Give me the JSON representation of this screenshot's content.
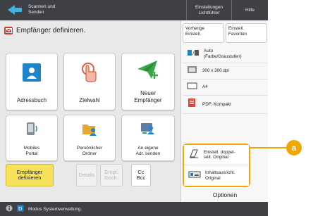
{
  "topbar": {
    "back_label": "Scannen und\nSenden",
    "settings_label": "Einstellungen\nLichtfühler",
    "help_label": "Hilfe"
  },
  "header": {
    "title": "Empfänger definieren."
  },
  "tiles": [
    {
      "label": "Adressbuch",
      "icon": "address-book-icon"
    },
    {
      "label": "Zielwahl",
      "icon": "one-touch-icon"
    },
    {
      "label": "Neuer\nEmpfänger",
      "icon": "new-destination-icon"
    },
    {
      "label": "Mobiles\nPortal",
      "icon": "mobile-portal-icon"
    },
    {
      "label": "Persönlicher\nOrdner",
      "icon": "personal-folder-icon"
    },
    {
      "label": "An eigene\nAdr. senden",
      "icon": "send-to-myself-icon"
    }
  ],
  "bottom_buttons": {
    "define": "Empfänger\ndefinieren",
    "details": "Details",
    "delete": "Empf.\nlösch.",
    "ccbcc": "Cc\nBcc"
  },
  "right_panel": {
    "prev_settings": "Vorherige\nEinstell.",
    "favorites": "Einstell.\nFavoriten",
    "items": [
      {
        "label": "Auto\n(Farbe/Graustufen)",
        "icon": "color-mode-icon"
      },
      {
        "label": "300 x 300 dpi",
        "icon": "resolution-icon"
      },
      {
        "label": "A4",
        "icon": "paper-size-icon"
      },
      {
        "label": "PDF; Kompakt",
        "icon": "file-format-icon"
      }
    ],
    "highlighted": [
      {
        "label": "Einstell. doppel-\nseit. Original",
        "icon": "two-sided-icon"
      },
      {
        "label": "Inhaltsausricht.\nOriginal",
        "icon": "orientation-icon"
      }
    ],
    "options": "Optionen"
  },
  "statusbar": {
    "text": "Modus Systemverwaltung."
  },
  "callout": {
    "label": "a"
  },
  "colors": {
    "accent": "#f0a800",
    "topbar": "#3f3f46",
    "yellow_button": "#f6e25a",
    "header_icon": "#d33a2c"
  }
}
